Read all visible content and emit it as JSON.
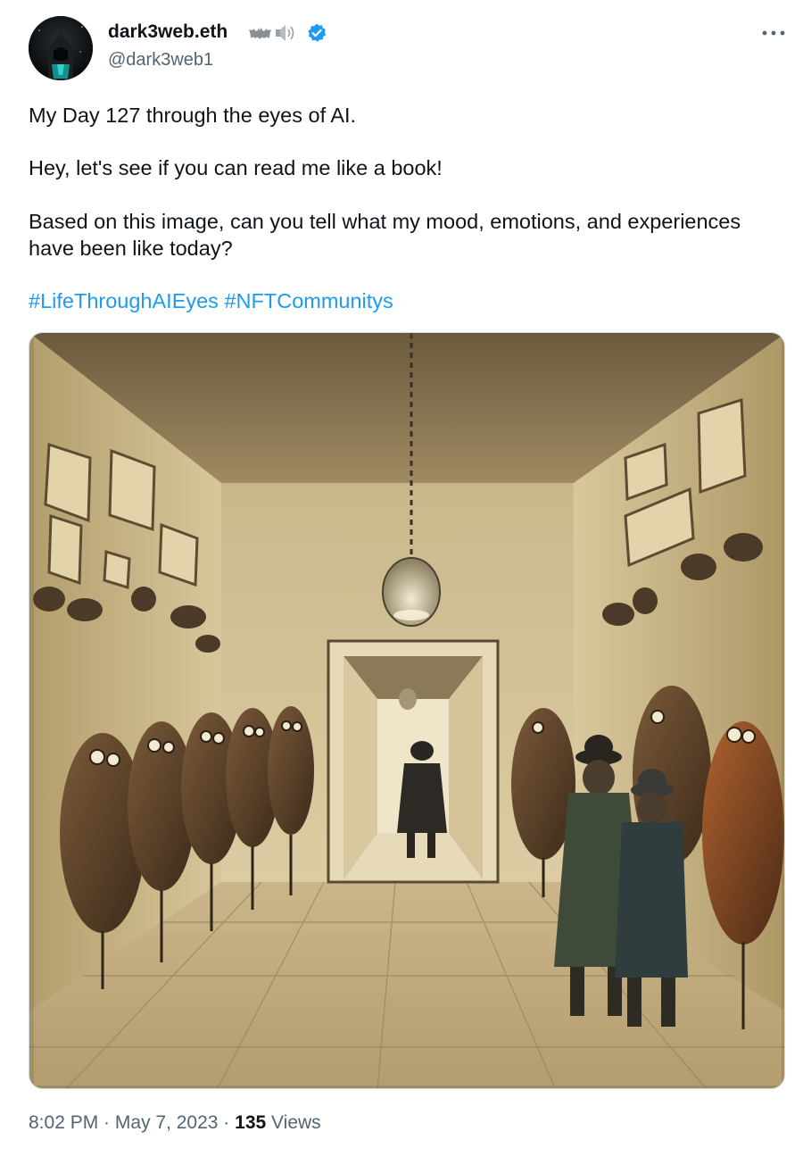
{
  "author": {
    "display_name": "dark3web.eth",
    "name_emojis": [
      "bat-emoji",
      "speaker-emoji"
    ],
    "handle": "@dark3web1",
    "verified": true,
    "verified_color": "#1d9bf0"
  },
  "more_icon": "more-horizontal-icon",
  "tweet": {
    "line1": "My Day 127 through the eyes of AI.",
    "line2": "Hey, let's see if you can read me like a book!",
    "line3": "Based on this image, can you tell what my mood, emotions, and experiences have been like today?",
    "hashtags": [
      "#LifeThroughAIEyes",
      "#NFTCommunitys"
    ],
    "hashtag_color": "#1d9bf0"
  },
  "media": {
    "kind": "illustration"
  },
  "meta": {
    "time": "8:02 PM",
    "sep1": " · ",
    "date": "May 7, 2023",
    "sep2": " · ",
    "views_count": "135",
    "views_label": " Views"
  }
}
